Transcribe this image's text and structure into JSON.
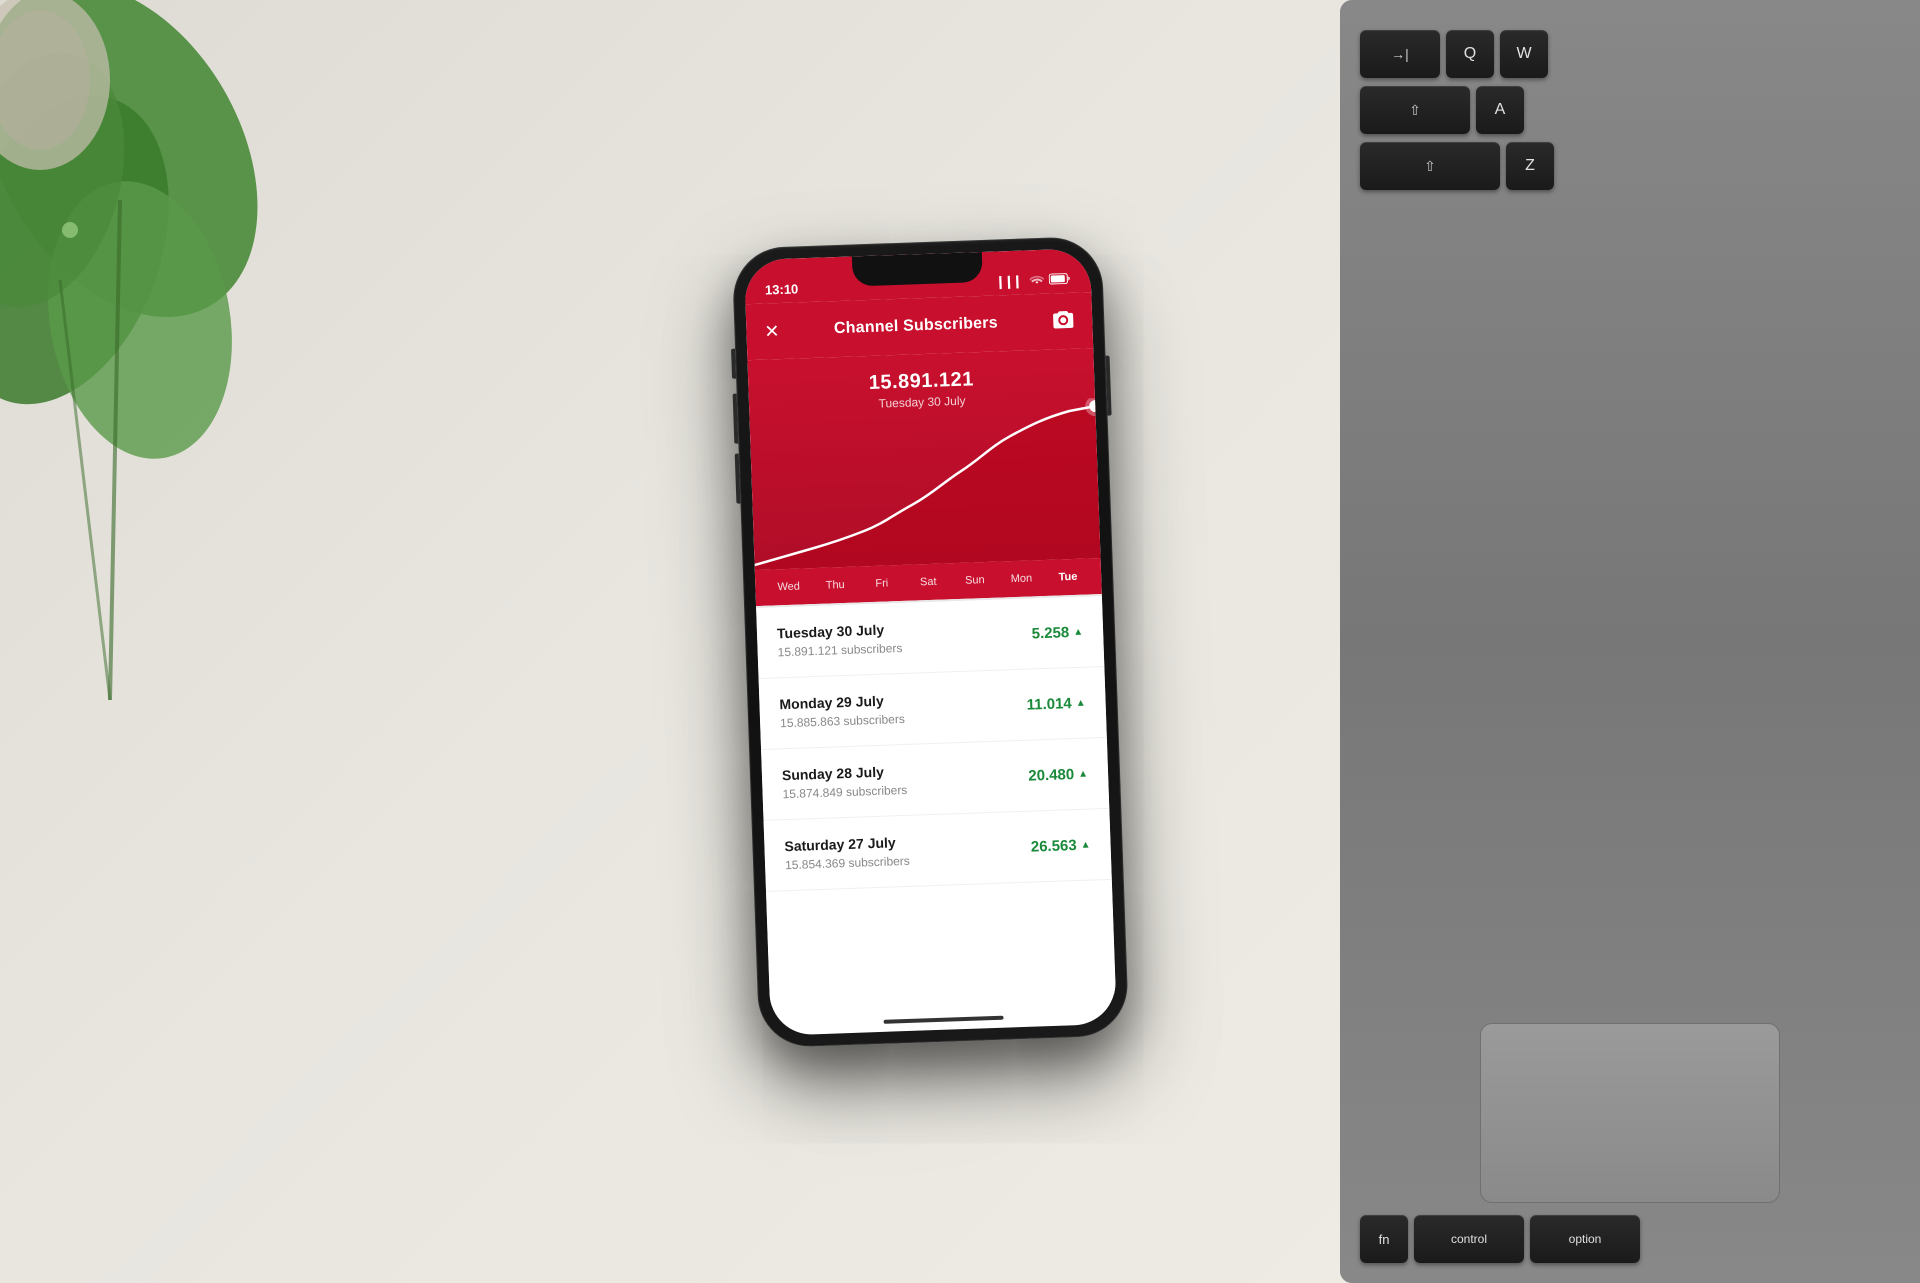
{
  "desk": {
    "background_color": "#e8e6df"
  },
  "phone": {
    "status_bar": {
      "time": "13:10",
      "signal": "▎▎▎",
      "wifi": "wifi",
      "battery": "battery"
    },
    "header": {
      "title": "Channel Subscribers",
      "close_icon": "✕",
      "camera_icon": "⊡"
    },
    "chart": {
      "number": "15.891.121",
      "date": "Tuesday 30 July"
    },
    "day_labels": [
      "Wed",
      "Thu",
      "Fri",
      "Sat",
      "Sun",
      "Mon",
      "Tue"
    ],
    "data_rows": [
      {
        "title": "Tuesday 30 July",
        "subscribers": "15.891.121 subscribers",
        "value": "5.258",
        "arrow": "▲"
      },
      {
        "title": "Monday 29 July",
        "subscribers": "15.885.863 subscribers",
        "value": "11.014",
        "arrow": "▲"
      },
      {
        "title": "Sunday 28 July",
        "subscribers": "15.874.849 subscribers",
        "value": "20.480",
        "arrow": "▲"
      },
      {
        "title": "Saturday 27 July",
        "subscribers": "15.854.369 subscribers",
        "value": "26.563",
        "arrow": "▲"
      }
    ]
  },
  "keyboard": {
    "rows": [
      [
        {
          "label": "→|",
          "subLabel": "",
          "width": "wide"
        },
        {
          "label": "Q",
          "subLabel": "",
          "width": "normal"
        },
        {
          "label": "W",
          "subLabel": "",
          "width": "normal"
        }
      ],
      [
        {
          "label": "⇧",
          "subLabel": "",
          "width": "wide"
        },
        {
          "label": "A",
          "subLabel": "",
          "width": "normal"
        }
      ],
      [
        {
          "label": "⇧",
          "subLabel": "",
          "width": "wide"
        },
        {
          "label": "Z",
          "subLabel": "",
          "width": "normal"
        }
      ],
      [
        {
          "label": "fn",
          "subLabel": "",
          "width": "normal"
        },
        {
          "label": "control",
          "subLabel": "",
          "width": "wider"
        },
        {
          "label": "option",
          "subLabel": "",
          "width": "wider"
        }
      ]
    ]
  }
}
